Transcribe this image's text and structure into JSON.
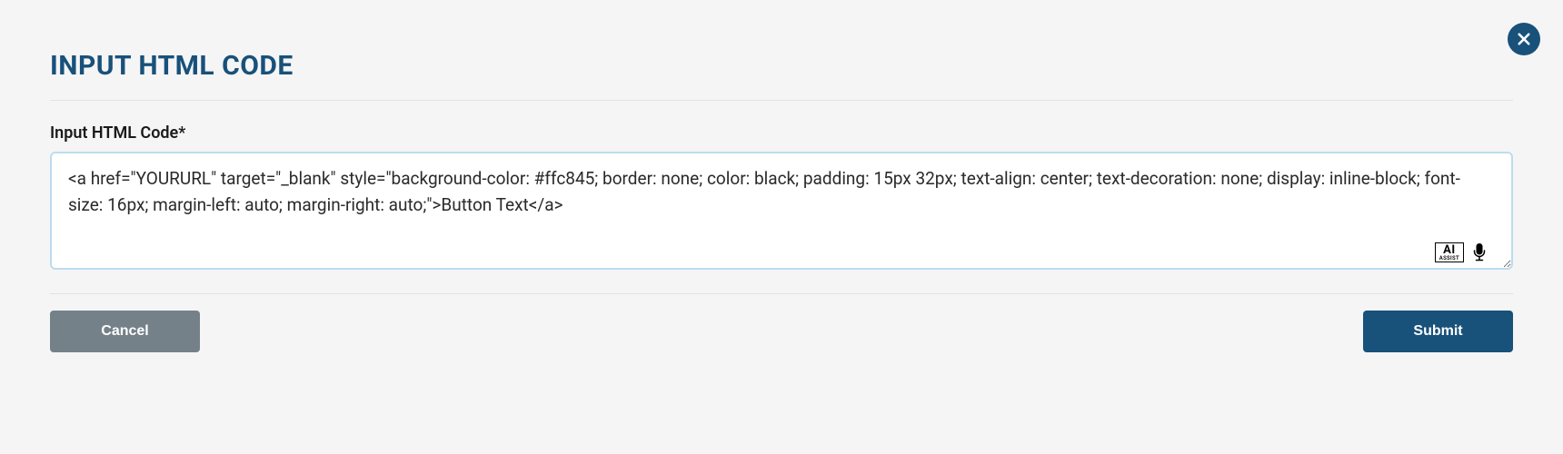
{
  "modal": {
    "title": "INPUT HTML CODE",
    "field_label": "Input HTML Code*",
    "textarea_value": "<a href=\"YOURURL\" target=\"_blank\" style=\"background-color: #ffc845; border: none; color: black; padding: 15px 32px; text-align: center; text-decoration: none; display: inline-block; font-size: 16px; margin-left: auto; margin-right: auto;\">Button Text</a>",
    "ai_assist": {
      "top": "AI",
      "bottom": "ASSIST"
    },
    "buttons": {
      "cancel_label": "Cancel",
      "submit_label": "Submit"
    }
  }
}
